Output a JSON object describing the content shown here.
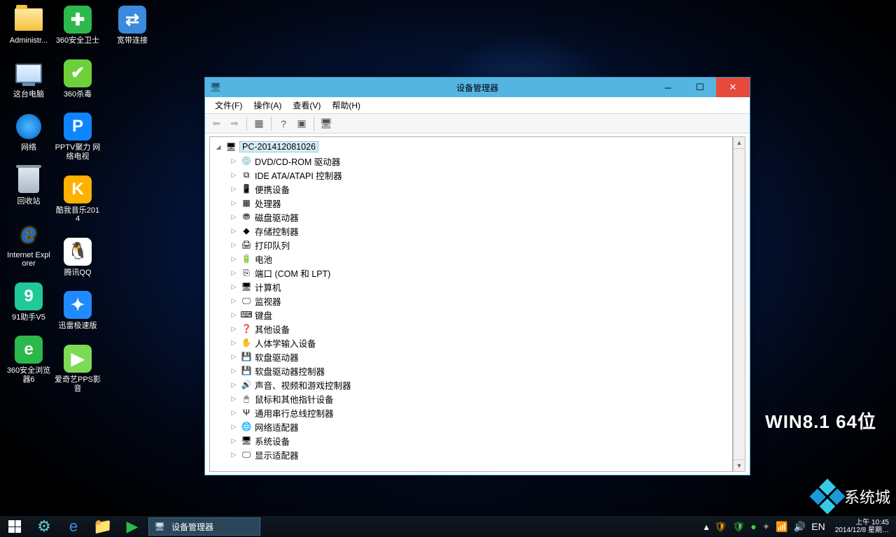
{
  "os_label": "WIN8.1  64位",
  "watermark_text": "系统城",
  "desktop_icons": {
    "col1": [
      {
        "key": "administrator",
        "label": "Administr...",
        "kind": "folder"
      },
      {
        "key": "this-pc",
        "label": "这台电脑",
        "kind": "pc"
      },
      {
        "key": "network",
        "label": "网络",
        "kind": "net"
      },
      {
        "key": "recycle-bin",
        "label": "回收站",
        "kind": "bin"
      },
      {
        "key": "ie",
        "label": "Internet Explorer",
        "kind": "ie"
      },
      {
        "key": "91helper",
        "label": "91助手V5",
        "kind": "app",
        "bg": "#20c997",
        "glyph": "9"
      },
      {
        "key": "360browser",
        "label": "360安全浏览器6",
        "kind": "app",
        "bg": "#2db84d",
        "glyph": "e"
      }
    ],
    "col2": [
      {
        "key": "360safe",
        "label": "360安全卫士",
        "kind": "app",
        "bg": "#2db84d",
        "glyph": "✚"
      },
      {
        "key": "360av",
        "label": "360杀毒",
        "kind": "app",
        "bg": "#6dd03a",
        "glyph": "✔"
      },
      {
        "key": "pptv",
        "label": "PPTV聚力 网络电视",
        "kind": "app",
        "bg": "#0f84ff",
        "glyph": "P"
      },
      {
        "key": "kuwo",
        "label": "酷我音乐2014",
        "kind": "app",
        "bg": "#ffb100",
        "glyph": "K"
      },
      {
        "key": "qq",
        "label": "腾讯QQ",
        "kind": "app",
        "bg": "#ffffff",
        "glyph": "🐧"
      },
      {
        "key": "xunlei",
        "label": "迅雷极速版",
        "kind": "app",
        "bg": "#1f8bff",
        "glyph": "✦"
      },
      {
        "key": "pps",
        "label": "爱奇艺PPS影音",
        "kind": "app",
        "bg": "#7ed957",
        "glyph": "▶"
      }
    ],
    "col3": [
      {
        "key": "broadband",
        "label": "宽带连接",
        "kind": "app",
        "bg": "#3a8add",
        "glyph": "⇄"
      }
    ]
  },
  "window": {
    "title": "设备管理器",
    "menus": [
      "文件(F)",
      "操作(A)",
      "查看(V)",
      "帮助(H)"
    ],
    "toolbar": [
      {
        "name": "back",
        "glyph": "⬅",
        "disabled": true
      },
      {
        "name": "forward",
        "glyph": "➡",
        "disabled": true
      },
      {
        "sep": true
      },
      {
        "name": "show-hidden",
        "glyph": "▦",
        "disabled": false
      },
      {
        "sep": true
      },
      {
        "name": "help",
        "glyph": "?",
        "disabled": false
      },
      {
        "name": "properties",
        "glyph": "▣",
        "disabled": false
      },
      {
        "sep": true
      },
      {
        "name": "scan-hardware",
        "glyph": "🖥",
        "disabled": false
      }
    ],
    "tree": {
      "root_label": "PC-201412081026",
      "children": [
        {
          "label": "DVD/CD-ROM 驱动器",
          "icon": "💿"
        },
        {
          "label": "IDE ATA/ATAPI 控制器",
          "icon": "⧉"
        },
        {
          "label": "便携设备",
          "icon": "📱"
        },
        {
          "label": "处理器",
          "icon": "▦"
        },
        {
          "label": "磁盘驱动器",
          "icon": "⛃"
        },
        {
          "label": "存储控制器",
          "icon": "◆"
        },
        {
          "label": "打印队列",
          "icon": "🖨"
        },
        {
          "label": "电池",
          "icon": "🔋"
        },
        {
          "label": "端口 (COM 和 LPT)",
          "icon": "⎘"
        },
        {
          "label": "计算机",
          "icon": "🖥"
        },
        {
          "label": "监视器",
          "icon": "🖵"
        },
        {
          "label": "键盘",
          "icon": "⌨"
        },
        {
          "label": "其他设备",
          "icon": "❓"
        },
        {
          "label": "人体学输入设备",
          "icon": "✋"
        },
        {
          "label": "软盘驱动器",
          "icon": "💾"
        },
        {
          "label": "软盘驱动器控制器",
          "icon": "💾"
        },
        {
          "label": "声音、视频和游戏控制器",
          "icon": "🔊"
        },
        {
          "label": "鼠标和其他指针设备",
          "icon": "🖱"
        },
        {
          "label": "通用串行总线控制器",
          "icon": "Ψ"
        },
        {
          "label": "网络适配器",
          "icon": "🌐"
        },
        {
          "label": "系统设备",
          "icon": "🖥"
        },
        {
          "label": "显示适配器",
          "icon": "🖵"
        }
      ]
    }
  },
  "taskbar": {
    "pinned": [
      {
        "name": "store",
        "glyph": "⚙",
        "color": "#6cc"
      },
      {
        "name": "ie",
        "glyph": "e",
        "color": "#3b8de0"
      },
      {
        "name": "explorer",
        "glyph": "📁",
        "color": "#f5c23e"
      },
      {
        "name": "iqiyi",
        "glyph": "▶",
        "color": "#2db84d"
      }
    ],
    "active_task": "设备管理器",
    "tray": [
      {
        "name": "up",
        "glyph": "▴"
      },
      {
        "name": "shield1",
        "glyph": "🛡",
        "color": "#f0a000"
      },
      {
        "name": "shield2",
        "glyph": "🛡",
        "color": "#4dd04d"
      },
      {
        "name": "360",
        "glyph": "●",
        "color": "#3dd03d"
      },
      {
        "name": "tool",
        "glyph": "✦",
        "color": "#888"
      },
      {
        "name": "network",
        "glyph": "📶"
      },
      {
        "name": "volume",
        "glyph": "🔊"
      },
      {
        "name": "ime",
        "glyph": "EN"
      }
    ],
    "clock_time": "上午 10:45",
    "clock_date": "2014/12/8 星期…"
  }
}
